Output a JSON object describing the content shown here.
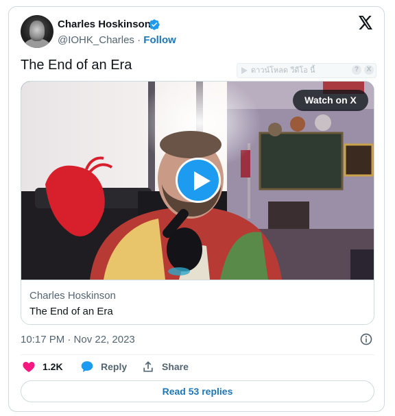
{
  "author": {
    "name": "Charles Hoskinson",
    "handle": "@IOHK_Charles",
    "separator": "·",
    "follow_label": "Follow"
  },
  "tweet": {
    "text": "The End of an Era"
  },
  "extension_overlay": {
    "download_label": "ดาวน์โหลด วีดีโอ นี้",
    "help_label": "?",
    "close_label": "X"
  },
  "media": {
    "watch_label": "Watch on X",
    "caption_author": "Charles Hoskinson",
    "caption_title": "The End of an Era"
  },
  "meta": {
    "timestamp": "10:17 PM · Nov 22, 2023"
  },
  "actions": {
    "like_count": "1.2K",
    "reply_label": "Reply",
    "share_label": "Share",
    "read_replies_label": "Read 53 replies"
  },
  "icons": {
    "verified": "verified-badge-icon",
    "x_logo": "x-logo-icon",
    "play": "play-icon",
    "info": "info-icon",
    "like": "heart-icon",
    "reply": "speech-bubble-icon",
    "share": "upload-arrow-icon"
  },
  "colors": {
    "accent": "#1d9bf0",
    "link": "#1d76b8",
    "like": "#f91880",
    "text": "#0f1419",
    "muted": "#536471",
    "border": "#cfd9de"
  }
}
